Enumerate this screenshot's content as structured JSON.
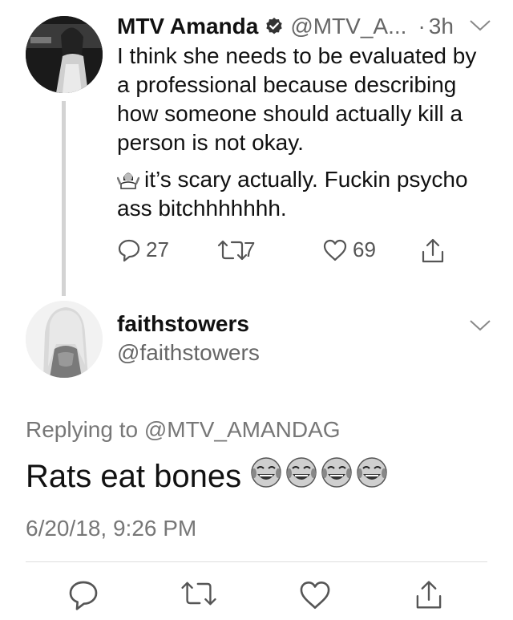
{
  "parent_tweet": {
    "display_name": "MTV Amanda",
    "handle": "@MTV_A...",
    "dot": "·",
    "time": "3h",
    "text_line1": "I think she needs to be evaluated by a professional because describing how someone should actually kill a person is not okay.",
    "text_line2": "it’s scary actually. Fuckin psycho ass bitchhhhhhh.",
    "reply_count": "27",
    "retweet_count": "7",
    "like_count": "69"
  },
  "main_tweet": {
    "display_name": "faithstowers",
    "handle": "@faithstowers",
    "replying_prefix": "Replying to",
    "replying_handle": "@MTV_AMANDAG",
    "text": "Rats eat bones",
    "emoji_count": 4,
    "timestamp": "6/20/18, 9:26 PM"
  },
  "icons": {
    "verified": "verified-badge-icon",
    "chevron": "chevron-down-icon",
    "reply": "reply-icon",
    "retweet": "retweet-icon",
    "like": "heart-icon",
    "share": "share-icon",
    "emoji_inline": "person-shrugging-emoji",
    "emoji_laugh": "face-with-tears-of-joy-emoji"
  },
  "colors": {
    "text": "#111111",
    "secondary": "#666666",
    "icon": "#555555",
    "thread_line": "#d3d3d3"
  }
}
